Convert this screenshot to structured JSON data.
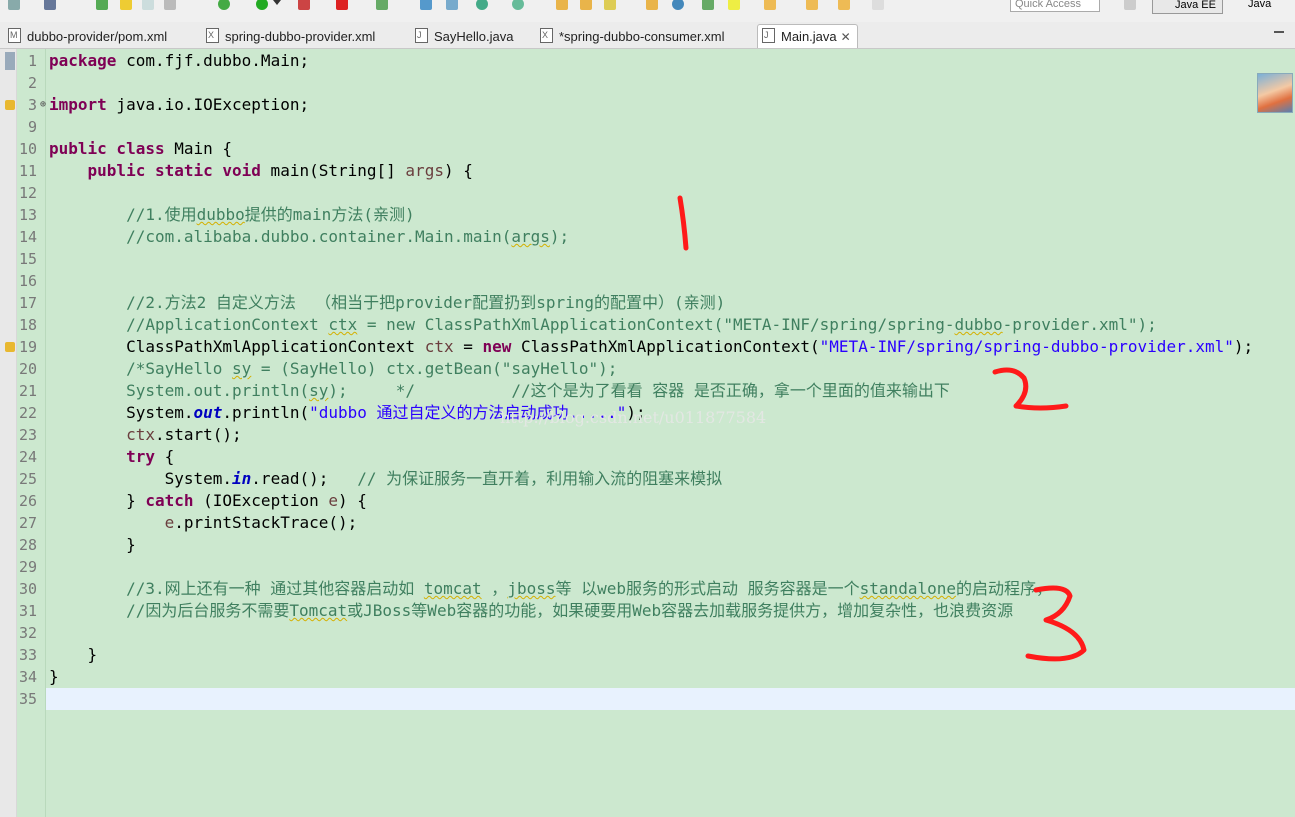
{
  "toolbar": {
    "quick_access_placeholder": "Quick Access",
    "perspective_java_ee": "Java EE",
    "perspective_java": "Java"
  },
  "tabs": [
    {
      "label": "dubbo-provider/pom.xml",
      "icon": "maven-file-icon",
      "active": false
    },
    {
      "label": "spring-dubbo-provider.xml",
      "icon": "xml-file-icon",
      "active": false
    },
    {
      "label": "SayHello.java",
      "icon": "java-file-icon",
      "active": false
    },
    {
      "label": "*spring-dubbo-consumer.xml",
      "icon": "xml-file-icon",
      "active": false
    },
    {
      "label": "Main.java",
      "icon": "java-file-icon",
      "active": true
    }
  ],
  "line_numbers": [
    "1",
    "2",
    "3",
    "9",
    "10",
    "11",
    "12",
    "13",
    "14",
    "15",
    "16",
    "17",
    "18",
    "19",
    "20",
    "21",
    "22",
    "23",
    "24",
    "25",
    "26",
    "27",
    "28",
    "29",
    "30",
    "31",
    "32",
    "33",
    "34",
    "35"
  ],
  "code": {
    "l1_kw": "package",
    "l1_rest": " com.fjf.dubbo.Main;",
    "l3_kw": "import",
    "l3_rest": " java.io.IOException;",
    "l10_kw": "public class",
    "l10_rest": " Main {",
    "l11_kw": "public static void",
    "l11_a": " main(String[] ",
    "l11_var": "args",
    "l11_b": ") {",
    "l13_a": "//1.使用",
    "l13_sq": "dubbo",
    "l13_b": "提供的main方法(亲测)",
    "l14_a": "//com.alibaba.dubbo.container.Main.main(",
    "l14_sq": "args",
    "l14_b": ");",
    "l17": "//2.方法2 自定义方法  （相当于把provider配置扔到spring的配置中）(亲测)",
    "l18_a": "//ApplicationContext ",
    "l18_sq": "ctx",
    "l18_b": " = new ClassPathXmlApplicationContext(\"META-INF/spring/spring-",
    "l18_sq2": "dubbo",
    "l18_c": "-provider.xml\");",
    "l19_a": "ClassPathXmlApplicationContext ",
    "l19_var": "ctx",
    "l19_b": " = ",
    "l19_kw": "new",
    "l19_c": " ClassPathXmlApplicationContext(",
    "l19_str": "\"META-INF/spring/spring-dubbo-provider.xml\"",
    "l19_d": ");",
    "l20_a": "/*SayHello ",
    "l20_sq": "sy",
    "l20_b": " = (SayHello) ctx.getBean(\"sayHello\");",
    "l21_a": "System.out.println(",
    "l21_sq": "sy",
    "l21_b": ");     */          //这个是为了看看 容器 是否正确，拿一个里面的值来输出下",
    "l22_a": "System.",
    "l22_fld": "out",
    "l22_b": ".println(",
    "l22_str": "\"dubbo 通过自定义的方法启动成功.....\"",
    "l22_c": ");",
    "l23_var": "ctx",
    "l23_rest": ".start();",
    "l24_kw": "try",
    "l24_rest": " {",
    "l25_a": "System.",
    "l25_fld": "in",
    "l25_b": ".read();   ",
    "l25_cm": "// 为保证服务一直开着，利用输入流的阻塞来模拟",
    "l26_a": "} ",
    "l26_kw": "catch",
    "l26_b": " (IOException ",
    "l26_var": "e",
    "l26_c": ") {",
    "l27_var": "e",
    "l27_rest": ".printStackTrace();",
    "l28": "}",
    "l30_a": "//3.网上还有一种 通过其他容器启动如 ",
    "l30_sq1": "tomcat",
    "l30_b": " ，",
    "l30_sq2": "jboss",
    "l30_c": "等 以web服务的形式启动 服务容器是一个",
    "l30_sq3": "standalone",
    "l30_d": "的启动程序，",
    "l31_a": "//因为后台服务不需要",
    "l31_sq": "Tomcat",
    "l31_b": "或JBoss等Web容器的功能，如果硬要用Web容器去加载服务提供方，增加复杂性，也浪费资源",
    "l33": "}",
    "l34": "}"
  },
  "watermark": "http://blog.csdn.net/u011877584",
  "annotations": [
    "1",
    "2",
    "3"
  ],
  "colors": {
    "editor_bg": "#cce8cf",
    "keyword": "#7f0055",
    "comment": "#3f7f5f",
    "string": "#2a00ff",
    "ink": "#ff1a1a"
  }
}
